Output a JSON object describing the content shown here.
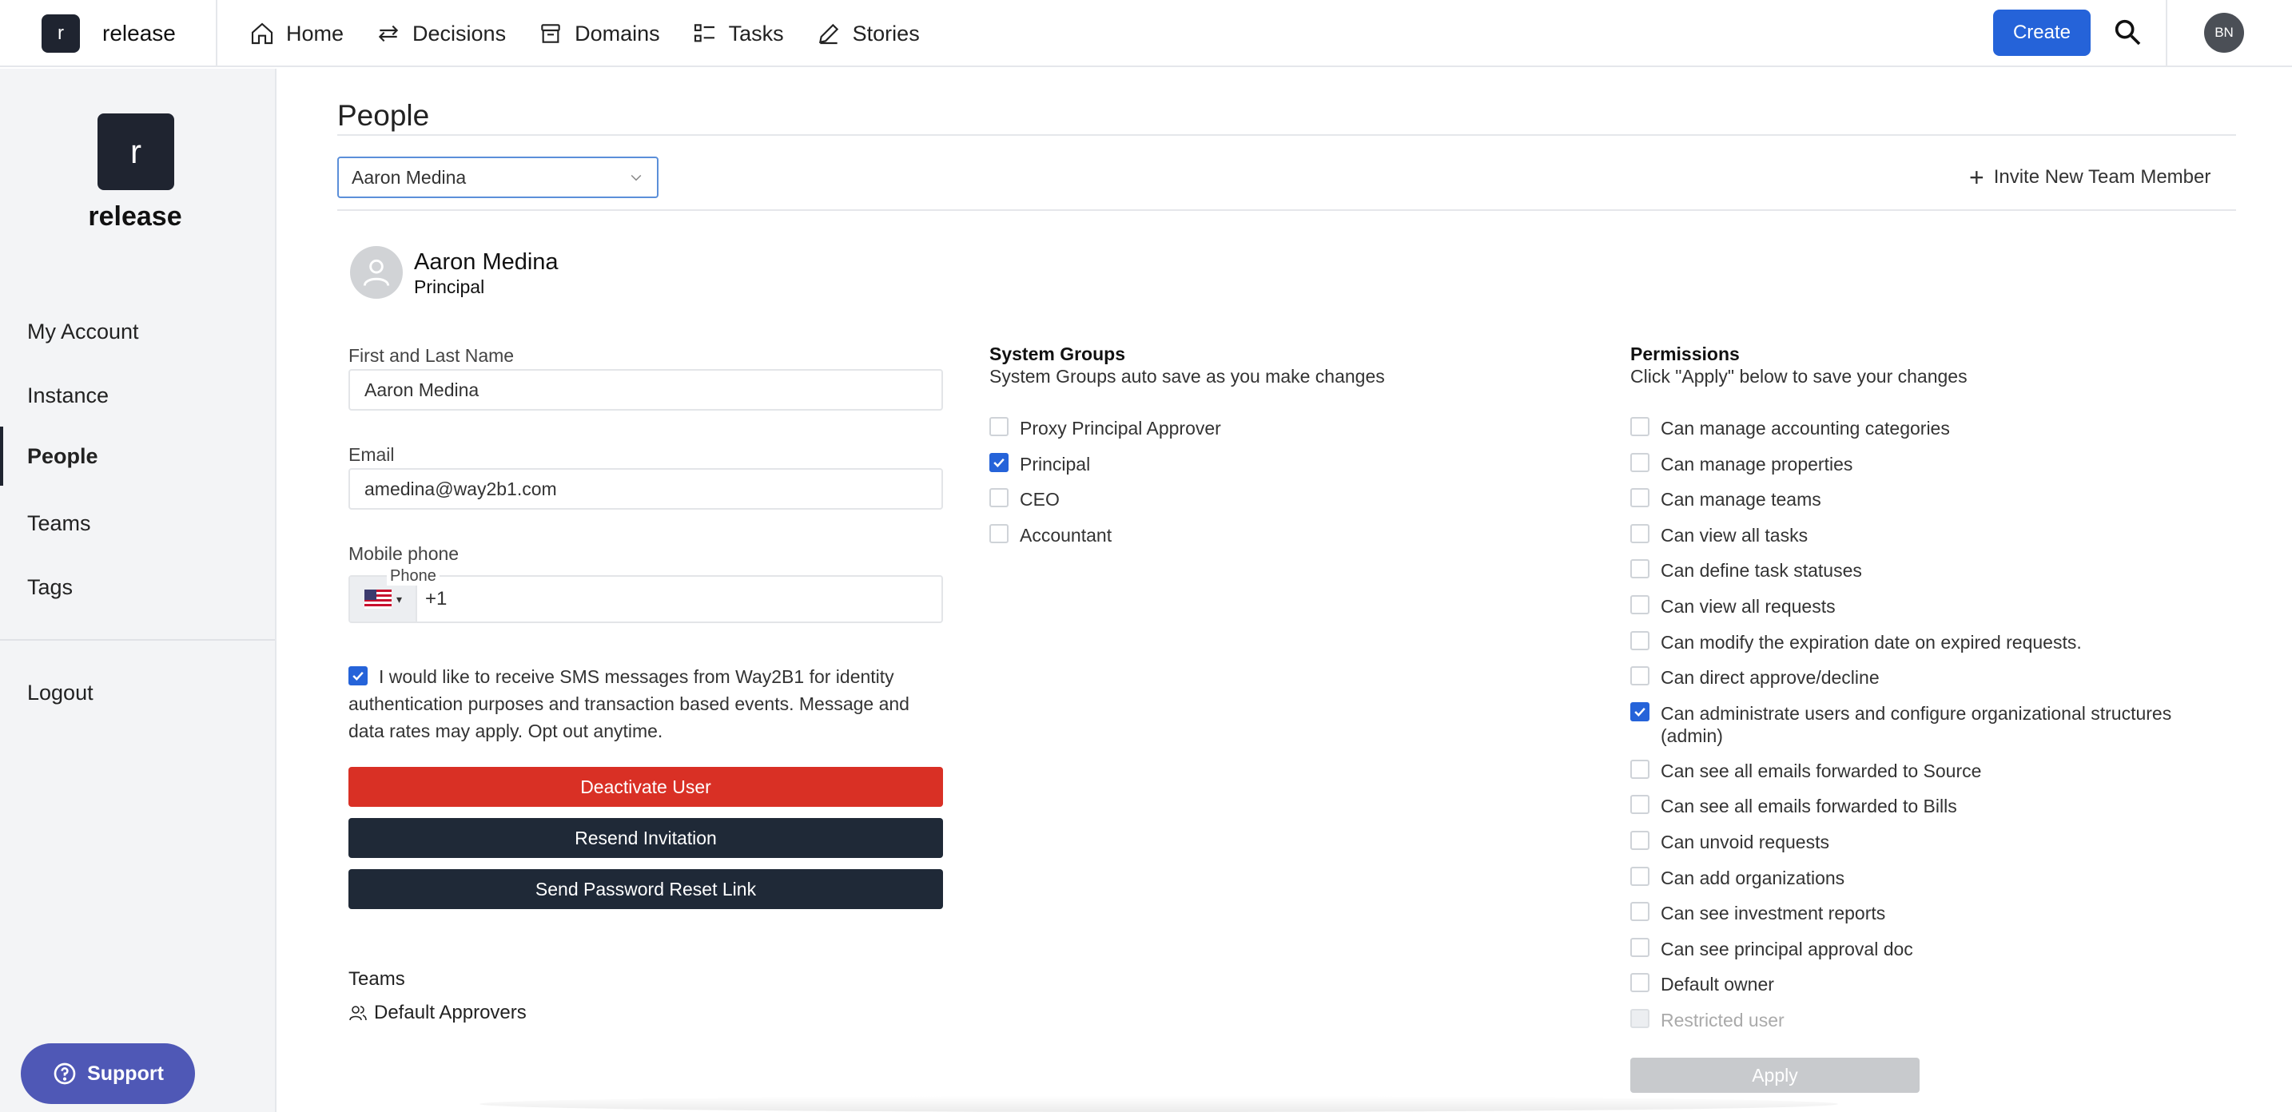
{
  "brand": {
    "logo_letter": "r",
    "name": "release"
  },
  "nav": {
    "items": [
      {
        "label": "Home",
        "icon": "home-icon"
      },
      {
        "label": "Decisions",
        "icon": "arrows-icon"
      },
      {
        "label": "Domains",
        "icon": "archive-icon"
      },
      {
        "label": "Tasks",
        "icon": "checklist-icon"
      },
      {
        "label": "Stories",
        "icon": "pencil-icon"
      }
    ],
    "create_label": "Create",
    "user_initials": "BN"
  },
  "sidebar": {
    "logo_letter": "r",
    "name": "release",
    "items": [
      "My Account",
      "Instance",
      "People",
      "Teams",
      "Tags"
    ],
    "active": "People",
    "logout": "Logout",
    "support": "Support"
  },
  "page": {
    "title": "People",
    "selected_person": "Aaron Medina",
    "invite_label": "Invite New Team Member"
  },
  "person": {
    "name": "Aaron Medina",
    "role": "Principal",
    "name_label": "First and Last Name",
    "name_value": "Aaron Medina",
    "email_label": "Email",
    "email_value": "amedina@way2b1.com",
    "phone_label": "Mobile phone",
    "phone_tag": "Phone",
    "phone_code": "+1",
    "sms_consent": "I would like to receive SMS messages from Way2B1 for identity authentication purposes and transaction based events. Message and data rates may apply. Opt out anytime.",
    "sms_checked": true,
    "deactivate_label": "Deactivate User",
    "resend_label": "Resend Invitation",
    "reset_label": "Send Password Reset Link",
    "teams_label": "Teams",
    "teams": [
      "Default Approvers"
    ]
  },
  "system_groups": {
    "heading": "System Groups",
    "subtitle": "System Groups auto save as you make changes",
    "items": [
      {
        "label": "Proxy Principal Approver",
        "checked": false
      },
      {
        "label": "Principal",
        "checked": true
      },
      {
        "label": "CEO",
        "checked": false
      },
      {
        "label": "Accountant",
        "checked": false
      }
    ]
  },
  "permissions": {
    "heading": "Permissions",
    "subtitle": "Click \"Apply\" below to save your changes",
    "items": [
      {
        "label": "Can manage accounting categories",
        "checked": false
      },
      {
        "label": "Can manage properties",
        "checked": false
      },
      {
        "label": "Can manage teams",
        "checked": false
      },
      {
        "label": "Can view all tasks",
        "checked": false
      },
      {
        "label": "Can define task statuses",
        "checked": false
      },
      {
        "label": "Can view all requests",
        "checked": false
      },
      {
        "label": "Can modify the expiration date on expired requests.",
        "checked": false
      },
      {
        "label": "Can direct approve/decline",
        "checked": false
      },
      {
        "label": "Can administrate users and configure organizational structures (admin)",
        "checked": true
      },
      {
        "label": "Can see all emails forwarded to Source",
        "checked": false
      },
      {
        "label": "Can see all emails forwarded to Bills",
        "checked": false
      },
      {
        "label": "Can unvoid requests",
        "checked": false
      },
      {
        "label": "Can add organizations",
        "checked": false
      },
      {
        "label": "Can see investment reports",
        "checked": false
      },
      {
        "label": "Can see principal approval doc",
        "checked": false
      },
      {
        "label": "Default owner",
        "checked": false
      },
      {
        "label": "Restricted user",
        "checked": false,
        "disabled": true
      }
    ],
    "apply_label": "Apply"
  },
  "colors": {
    "primary": "#2563d9",
    "danger": "#d93025",
    "dark": "#1f2937",
    "support": "#4f58b6"
  }
}
